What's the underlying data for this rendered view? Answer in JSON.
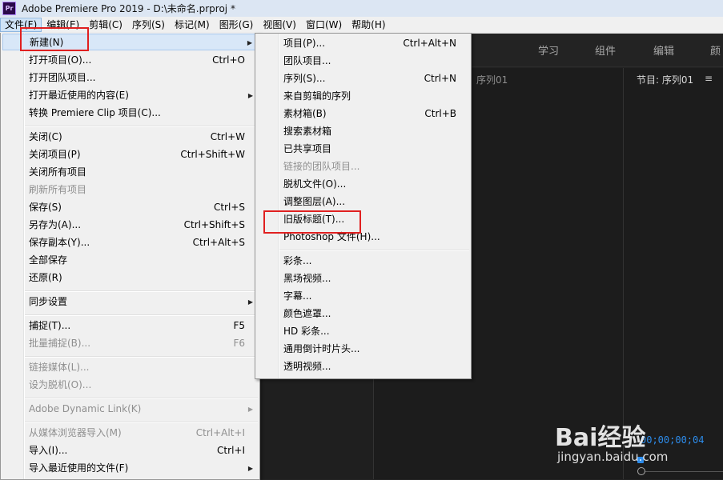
{
  "window": {
    "title": "Adobe Premiere Pro 2019 - D:\\未命名.prproj *",
    "logo": "Pr"
  },
  "menubar": [
    "文件(F)",
    "编辑(E)",
    "剪辑(C)",
    "序列(S)",
    "标记(M)",
    "图形(G)",
    "视图(V)",
    "窗口(W)",
    "帮助(H)"
  ],
  "workspaces": [
    "学习",
    "组件",
    "编辑",
    "颜"
  ],
  "panels": {
    "source_title": "序列01",
    "program_title": "节目: 序列01",
    "program_menu": "≡",
    "timecode": "00;00;00;04"
  },
  "file_menu": [
    {
      "label": "新建(N)",
      "shortcut": "",
      "submenu": true,
      "highlighted": true
    },
    {
      "label": "打开项目(O)...",
      "shortcut": "Ctrl+O"
    },
    {
      "label": "打开团队项目..."
    },
    {
      "label": "打开最近使用的内容(E)",
      "submenu": true
    },
    {
      "label": "转换 Premiere Clip 项目(C)..."
    },
    {
      "label": "关闭(C)",
      "shortcut": "Ctrl+W"
    },
    {
      "label": "关闭项目(P)",
      "shortcut": "Ctrl+Shift+W"
    },
    {
      "label": "关闭所有项目"
    },
    {
      "label": "刷新所有项目",
      "disabled": true
    },
    {
      "label": "保存(S)",
      "shortcut": "Ctrl+S"
    },
    {
      "label": "另存为(A)...",
      "shortcut": "Ctrl+Shift+S"
    },
    {
      "label": "保存副本(Y)...",
      "shortcut": "Ctrl+Alt+S"
    },
    {
      "label": "全部保存"
    },
    {
      "label": "还原(R)"
    },
    {
      "label": "同步设置",
      "submenu": true
    },
    {
      "label": "捕捉(T)...",
      "shortcut": "F5"
    },
    {
      "label": "批量捕捉(B)...",
      "shortcut": "F6",
      "disabled": true
    },
    {
      "label": "链接媒体(L)...",
      "disabled": true
    },
    {
      "label": "设为脱机(O)...",
      "disabled": true
    },
    {
      "label": "Adobe Dynamic Link(K)",
      "submenu": true,
      "disabled": true
    },
    {
      "label": "从媒体浏览器导入(M)",
      "shortcut": "Ctrl+Alt+I",
      "disabled": true
    },
    {
      "label": "导入(I)...",
      "shortcut": "Ctrl+I"
    },
    {
      "label": "导入最近使用的文件(F)",
      "submenu": true
    }
  ],
  "new_menu": [
    {
      "label": "项目(P)...",
      "shortcut": "Ctrl+Alt+N"
    },
    {
      "label": "团队项目..."
    },
    {
      "label": "序列(S)...",
      "shortcut": "Ctrl+N"
    },
    {
      "label": "来自剪辑的序列"
    },
    {
      "label": "素材箱(B)",
      "shortcut": "Ctrl+B"
    },
    {
      "label": "搜索素材箱"
    },
    {
      "label": "已共享项目"
    },
    {
      "label": "链接的团队项目...",
      "disabled": true
    },
    {
      "label": "脱机文件(O)..."
    },
    {
      "label": "调整图层(A)..."
    },
    {
      "label": "旧版标题(T)..."
    },
    {
      "label": "Photoshop 文件(H)..."
    },
    {
      "label": "彩条..."
    },
    {
      "label": "黑场视频..."
    },
    {
      "label": "字幕..."
    },
    {
      "label": "颜色遮罩..."
    },
    {
      "label": "HD 彩条..."
    },
    {
      "label": "通用倒计时片头..."
    },
    {
      "label": "透明视频..."
    }
  ],
  "watermark": {
    "brand": "Bai经验",
    "url": "jingyan.baidu.com"
  },
  "colors": {
    "highlight": "#d8e7f8",
    "annotation_red": "#e02020",
    "timecode_blue": "#2d8ceb"
  }
}
